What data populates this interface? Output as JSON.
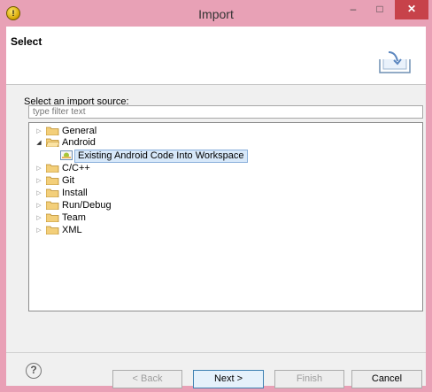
{
  "window": {
    "title": "Import",
    "minimize": "–",
    "maximize": "□",
    "close": "✕"
  },
  "header": {
    "title": "Select"
  },
  "prompt": "Select an import source:",
  "filter": {
    "placeholder": "type filter text",
    "value": ""
  },
  "tree": [
    {
      "label": "General",
      "expanded": false
    },
    {
      "label": "Android",
      "expanded": true
    },
    {
      "label": "Existing Android Code Into Workspace",
      "selected": true
    },
    {
      "label": "C/C++",
      "expanded": false
    },
    {
      "label": "Git",
      "expanded": false
    },
    {
      "label": "Install",
      "expanded": false
    },
    {
      "label": "Run/Debug",
      "expanded": false
    },
    {
      "label": "Team",
      "expanded": false
    },
    {
      "label": "XML",
      "expanded": false
    }
  ],
  "buttons": {
    "help": "?",
    "back": "< Back",
    "next": "Next >",
    "finish": "Finish",
    "cancel": "Cancel"
  },
  "colors": {
    "titlebar": "#e8a1b6",
    "close": "#c7424a",
    "folder": "#e6b85c",
    "selection": "#d7e8f9"
  }
}
